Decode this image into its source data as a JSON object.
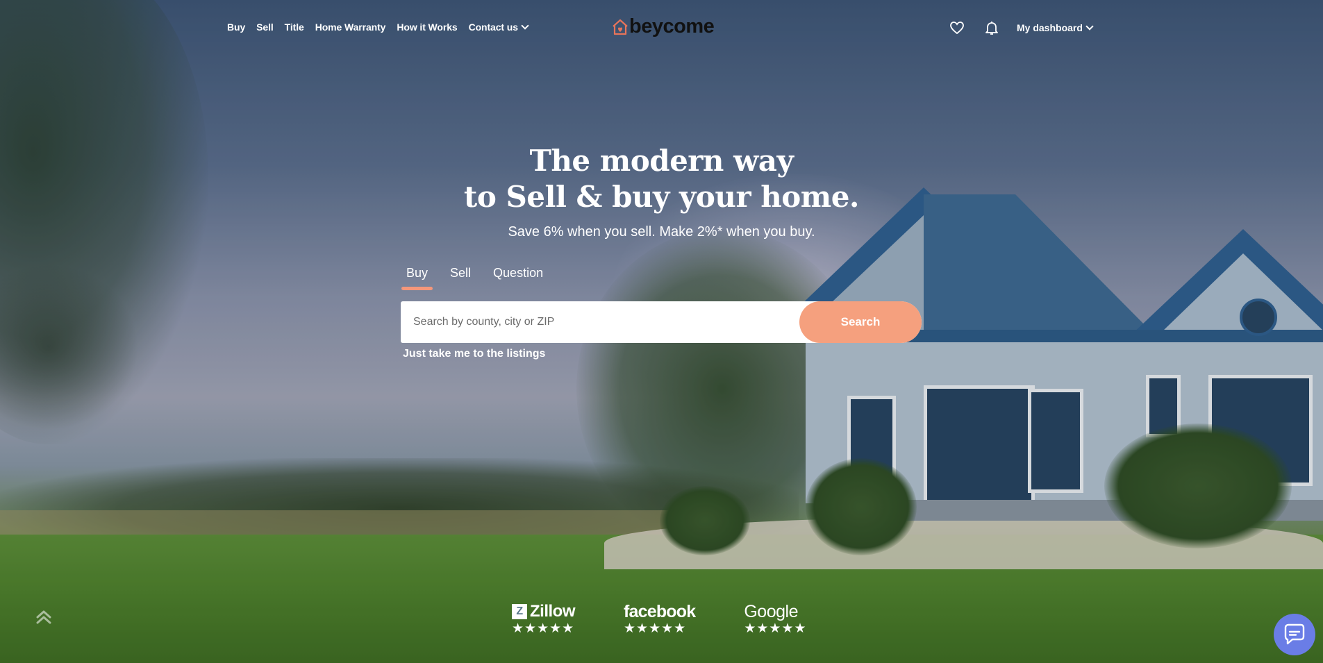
{
  "nav": {
    "links": [
      "Buy",
      "Sell",
      "Title",
      "Home Warranty",
      "How it Works",
      "Contact us"
    ],
    "logo_text": "beycome",
    "dashboard_label": "My dashboard",
    "icons": [
      "heart-icon",
      "bell-icon"
    ]
  },
  "hero": {
    "headline_line1": "The modern way",
    "headline_line2": "to Sell & buy your home.",
    "subline": "Save 6% when you sell. Make 2%* when you buy.",
    "tabs": [
      "Buy",
      "Sell",
      "Question"
    ],
    "active_tab": "Buy",
    "search_placeholder": "Search by county, city or ZIP",
    "search_value": "",
    "search_button": "Search",
    "listings_link": "Just take me to the listings"
  },
  "reviews": [
    {
      "brand": "Zillow",
      "stars": "★★★★★",
      "rating": 5
    },
    {
      "brand": "facebook",
      "stars": "★★★★★",
      "rating": 4.5
    },
    {
      "brand": "Google",
      "stars": "★★★★★",
      "rating": 5
    }
  ],
  "colors": {
    "accent": "#f5a07e",
    "tab_underline": "#f5977a",
    "chat_button": "#6a7de6",
    "logo_house": "#e8745a"
  }
}
